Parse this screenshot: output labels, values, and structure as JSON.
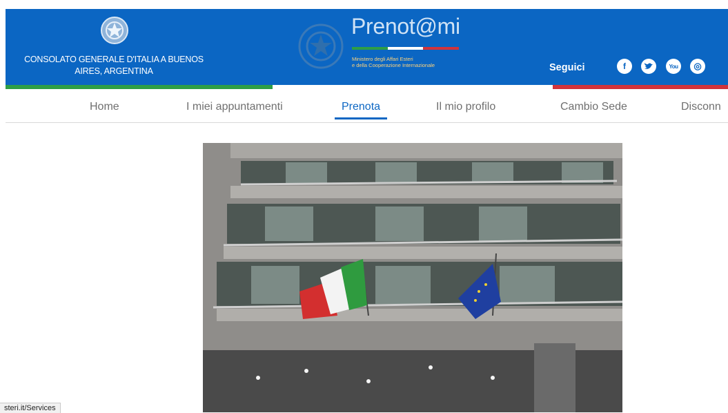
{
  "header": {
    "consulate_name": "CONSOLATO GENERALE D'ITALIA A BUENOS AIRES, ARGENTINA",
    "app_title": "Prenot@mi",
    "ministry_line1": "Ministero degli Affari Esteri",
    "ministry_line2": "e della Cooperazione Internazionale",
    "follow_label": "Seguici",
    "social": [
      {
        "name": "facebook",
        "glyph": "f"
      },
      {
        "name": "twitter",
        "glyph": "t"
      },
      {
        "name": "youtube",
        "glyph": "You"
      },
      {
        "name": "instagram",
        "glyph": "◎"
      }
    ]
  },
  "nav": {
    "items": [
      {
        "label": "Home"
      },
      {
        "label": "I miei appuntamenti"
      },
      {
        "label": "Prenota",
        "active": true
      },
      {
        "label": "Il mio profilo"
      },
      {
        "label": "Cambio Sede"
      },
      {
        "label": "Disconn"
      }
    ]
  },
  "status_bar": {
    "url": "steri.it/Services"
  },
  "colors": {
    "primary_blue": "#0b66c3",
    "flag_green": "#2e9e46",
    "flag_red": "#d1333b",
    "nav_text": "#6f6f6f"
  }
}
